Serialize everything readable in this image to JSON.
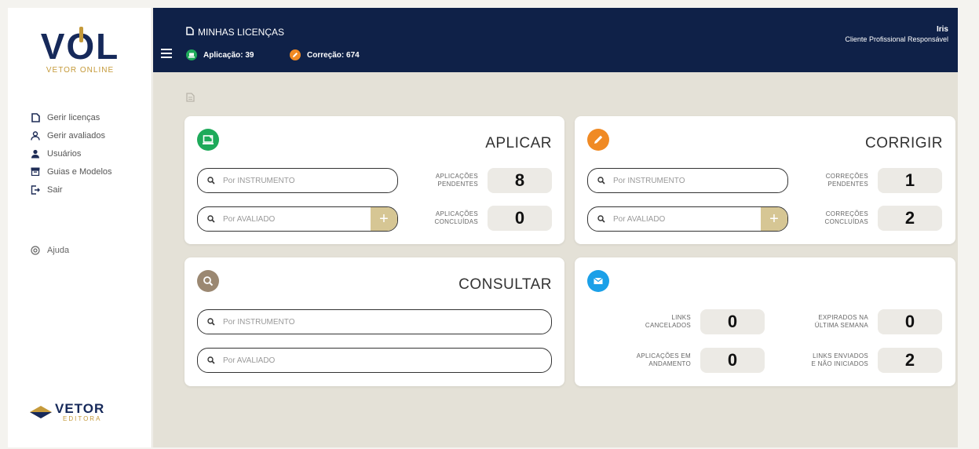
{
  "brand": {
    "logo_text_v": "V",
    "logo_text_o": "O",
    "logo_text_l": "L",
    "logo_subtitle": "VETOR ONLINE",
    "footer_name": "VETOR",
    "footer_sub": "EDITORA",
    "accent_gold": "#c59a3a",
    "navy": "#0f2148"
  },
  "sidebar": {
    "items": [
      {
        "label": "Gerir licenças",
        "icon": "document-icon"
      },
      {
        "label": "Gerir avaliados",
        "icon": "person-outline-icon"
      },
      {
        "label": "Usuários",
        "icon": "person-filled-icon"
      },
      {
        "label": "Guias e Modelos",
        "icon": "archive-icon"
      },
      {
        "label": "Sair",
        "icon": "logout-icon"
      }
    ],
    "help_label": "Ajuda"
  },
  "topbar": {
    "title": "MINHAS LICENÇAS",
    "aplicacao_label": "Aplicação: 39",
    "correcao_label": "Correção: 674",
    "user_name": "Iris",
    "user_role": "Cliente Profissional Responsável"
  },
  "aplicar": {
    "title": "APLICAR",
    "search_instrumento_placeholder": "Por INSTRUMENTO",
    "search_avaliado_placeholder": "Por AVALIADO",
    "pendentes_label_1": "APLICAÇÕES",
    "pendentes_label_2": "PENDENTES",
    "pendentes_value": "8",
    "concluidas_label_1": "APLICAÇÕES",
    "concluidas_label_2": "CONCLUÍDAS",
    "concluidas_value": "0",
    "color": "#1eaa5a"
  },
  "corrigir": {
    "title": "CORRIGIR",
    "search_instrumento_placeholder": "Por INSTRUMENTO",
    "search_avaliado_placeholder": "Por AVALIADO",
    "pendentes_label_1": "CORREÇÕES",
    "pendentes_label_2": "PENDENTES",
    "pendentes_value": "1",
    "concluidas_label_1": "CORREÇÕES",
    "concluidas_label_2": "CONCLUÍDAS",
    "concluidas_value": "2",
    "color": "#f08a24"
  },
  "consultar": {
    "title": "CONSULTAR",
    "search_instrumento_placeholder": "Por INSTRUMENTO",
    "search_avaliado_placeholder": "Por AVALIADO",
    "color": "#9b8872"
  },
  "links": {
    "color": "#1ba0e8",
    "cancelados_label_1": "LINKS",
    "cancelados_label_2": "CANCELADOS",
    "cancelados_value": "0",
    "expirados_label_1": "EXPIRADOS NA",
    "expirados_label_2": "ÚLTIMA SEMANA",
    "expirados_value": "0",
    "andamento_label_1": "APLICAÇÕES EM",
    "andamento_label_2": "ANDAMENTO",
    "andamento_value": "0",
    "enviados_label_1": "LINKS ENVIADOS",
    "enviados_label_2": "E NÃO INICIADOS",
    "enviados_value": "2"
  }
}
